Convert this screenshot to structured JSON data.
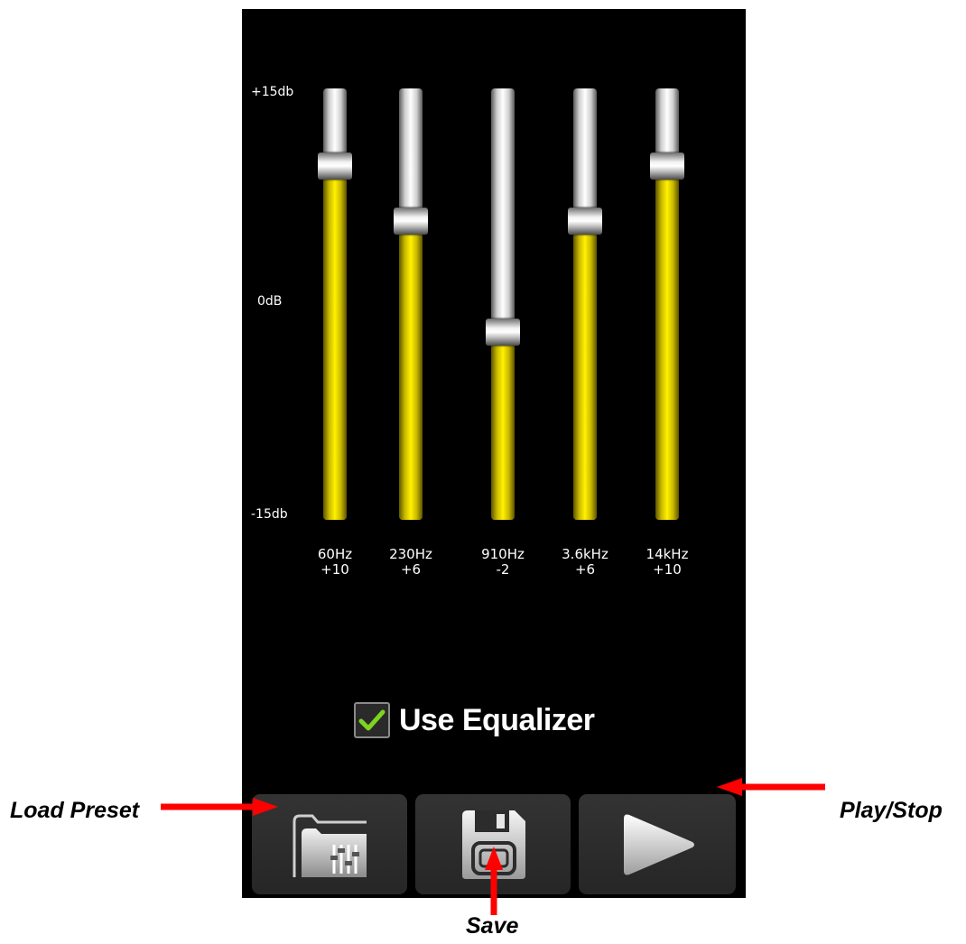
{
  "scale": {
    "top": "+15db",
    "mid": "0dB",
    "bottom": "-15db"
  },
  "range_db": [
    -15,
    15
  ],
  "bands": [
    {
      "freq": "60Hz",
      "value": "+10",
      "db": 10
    },
    {
      "freq": "230Hz",
      "value": "+6",
      "db": 6
    },
    {
      "freq": "910Hz",
      "value": "-2",
      "db": -2
    },
    {
      "freq": "3.6kHz",
      "value": "+6",
      "db": 6
    },
    {
      "freq": "14kHz",
      "value": "+10",
      "db": 10
    }
  ],
  "equalizer": {
    "label": "Use Equalizer",
    "checked": true
  },
  "buttons": {
    "load": "folder-equalizer-icon",
    "save": "floppy-disk-icon",
    "play": "play-icon"
  },
  "annotations": {
    "load_preset": "Load Preset",
    "play_stop": "Play/Stop",
    "save": "Save"
  },
  "colors": {
    "fill": "#fff200",
    "arrow": "#ff0000",
    "check": "#7ed321"
  }
}
